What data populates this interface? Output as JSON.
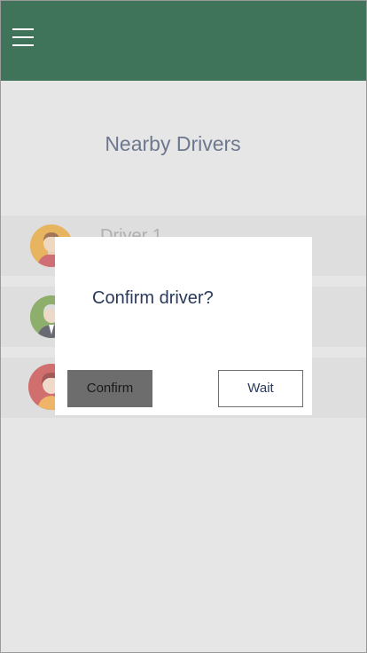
{
  "header": {
    "menu_icon": "hamburger-menu-icon",
    "bar_color": "#3f735a"
  },
  "page": {
    "title": "Nearby Drivers"
  },
  "drivers": [
    {
      "name": "Driver 1",
      "avatar_icon": "driver-avatar-icon",
      "avatar_color": "#e8a22b"
    },
    {
      "name": "",
      "avatar_icon": "driver-avatar-icon",
      "avatar_color": "#6c9a3c"
    },
    {
      "name": "",
      "avatar_icon": "driver-avatar-icon",
      "avatar_color": "#c94040"
    }
  ],
  "dialog": {
    "message": "Confirm driver?",
    "confirm_label": "Confirm",
    "wait_label": "Wait"
  }
}
